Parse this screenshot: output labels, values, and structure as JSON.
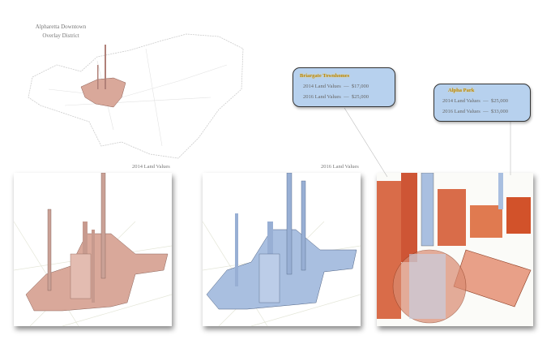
{
  "map_title": {
    "line1": "Alpharetta Downtown",
    "line2": "Overlay District"
  },
  "panels": {
    "label_2014": "2014 Land Values",
    "label_2016": "2016 Land Values"
  },
  "callouts": [
    {
      "title": "Briargate Townhomes",
      "rows": [
        {
          "label": "2014 Land Values",
          "sep": "—",
          "value": "$17,000"
        },
        {
          "label": "2016 Land Values",
          "sep": "—",
          "value": "$25,000"
        }
      ]
    },
    {
      "title": "Alpha Park",
      "rows": [
        {
          "label": "2014 Land Values",
          "sep": "—",
          "value": "$25,000"
        },
        {
          "label": "2016 Land Values",
          "sep": "—",
          "value": "$33,000"
        }
      ]
    }
  ],
  "colors": {
    "value_2014": "#d9a89a",
    "value_2016": "#a9bfe0",
    "detail": "#d2522a",
    "callout_bg": "#b7d1ee",
    "callout_title": "#b8860b"
  }
}
